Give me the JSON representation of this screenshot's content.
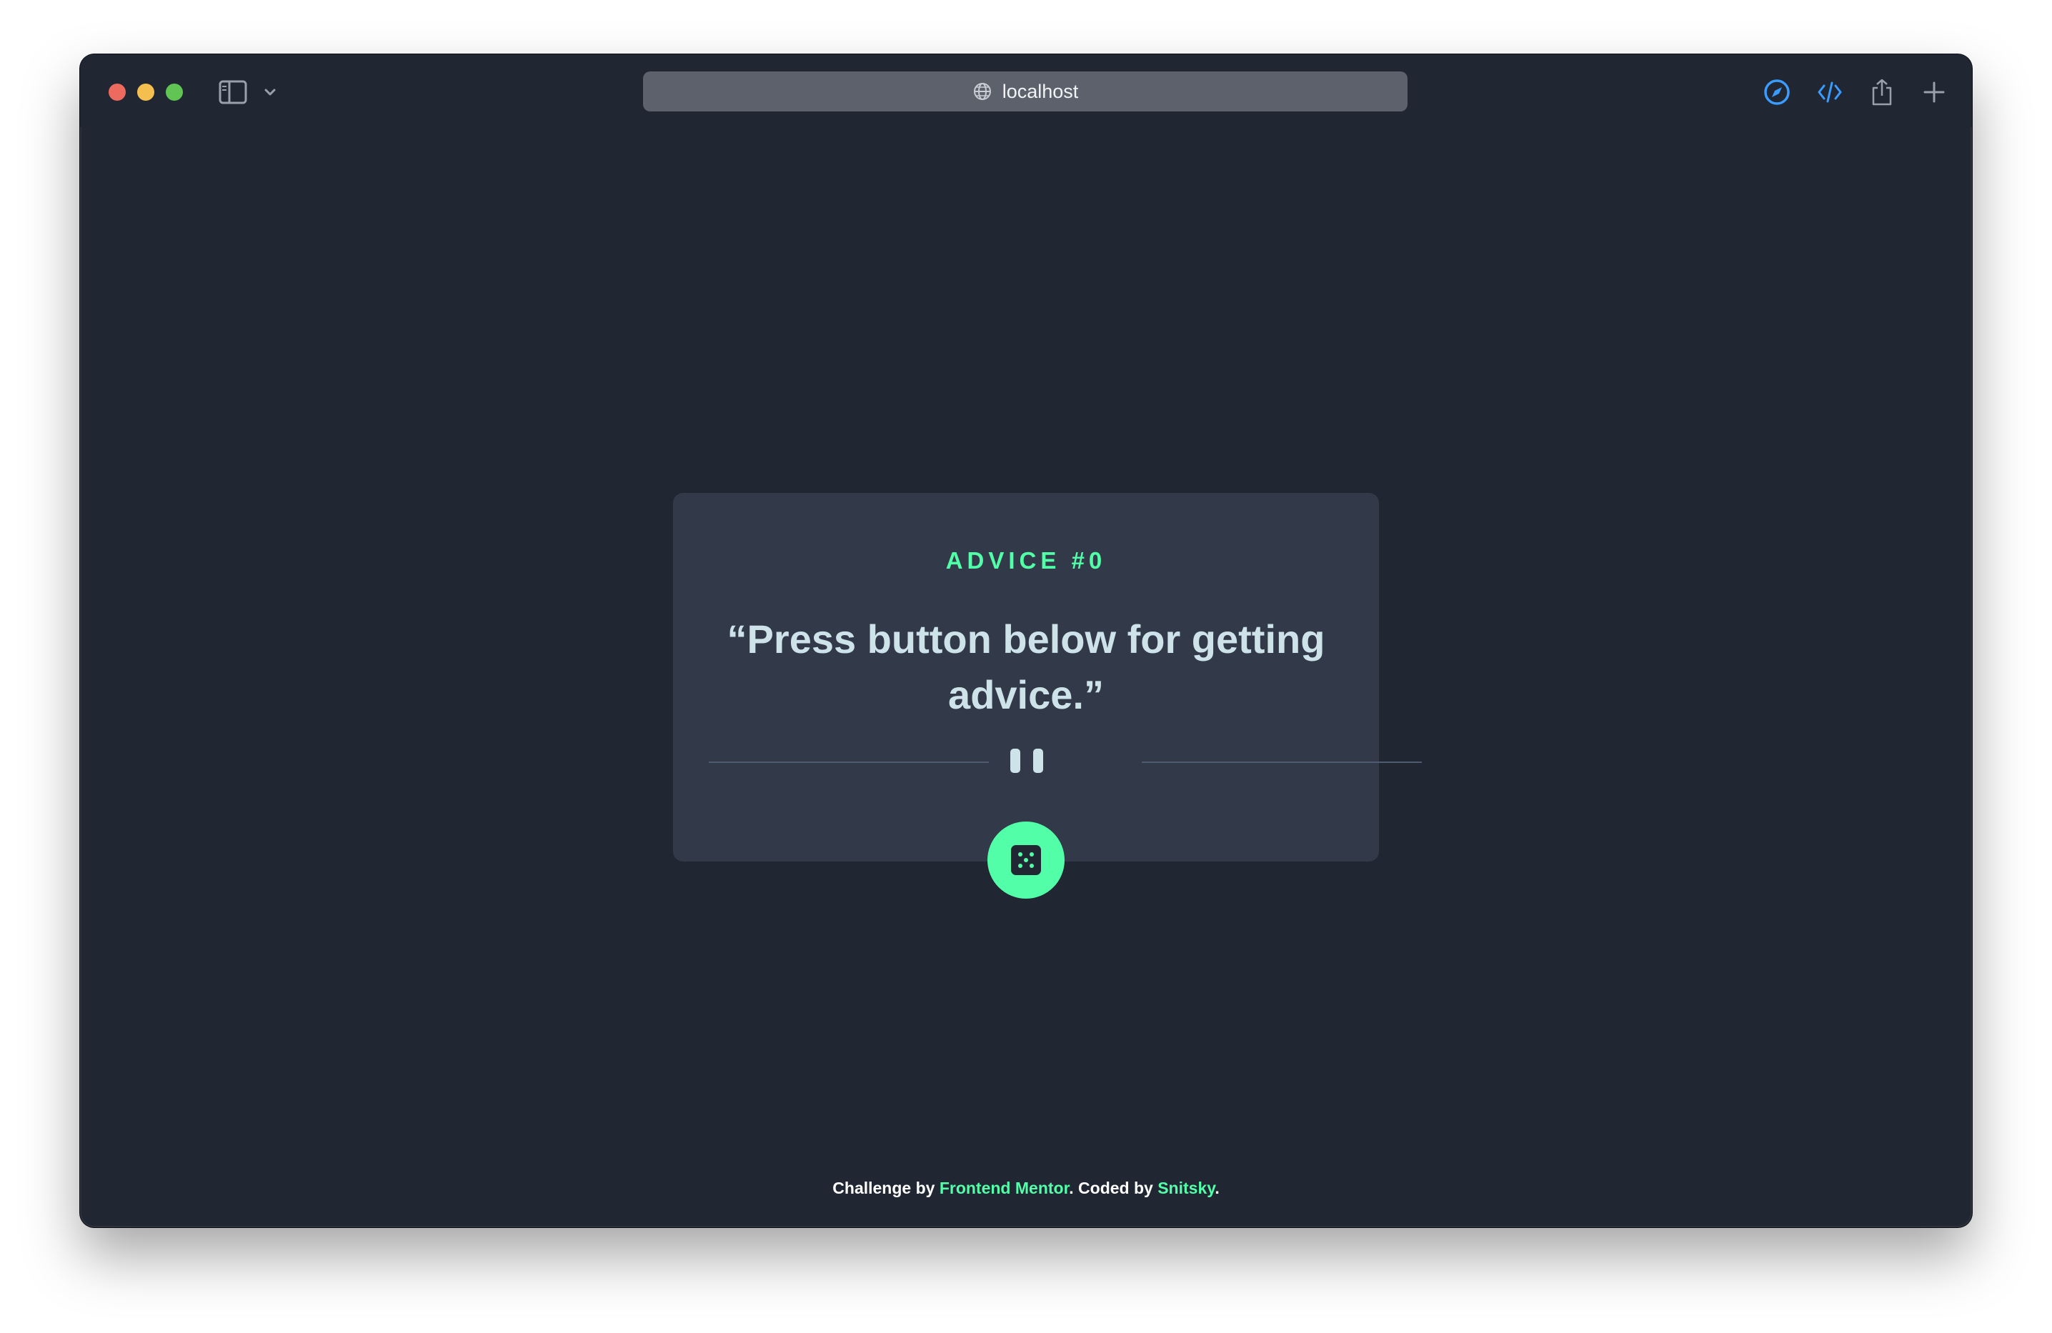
{
  "browser": {
    "address": "localhost",
    "icons": [
      "sidebar-icon",
      "chevron-down-icon",
      "globe-icon",
      "compass-icon",
      "code-icon",
      "share-icon",
      "plus-icon"
    ]
  },
  "card": {
    "title": "ADVICE #0",
    "quote": "“Press button below for getting advice.”",
    "button_icon": "dice-icon"
  },
  "footer": {
    "prefix": "Challenge by ",
    "challenge_link": "Frontend Mentor",
    "middle": ". Coded by ",
    "author_link": "Snitsky",
    "suffix": "."
  },
  "colors": {
    "background": "#202632",
    "card": "#323a49",
    "accent": "#52ffa8",
    "quote_text": "#cee3e9"
  }
}
